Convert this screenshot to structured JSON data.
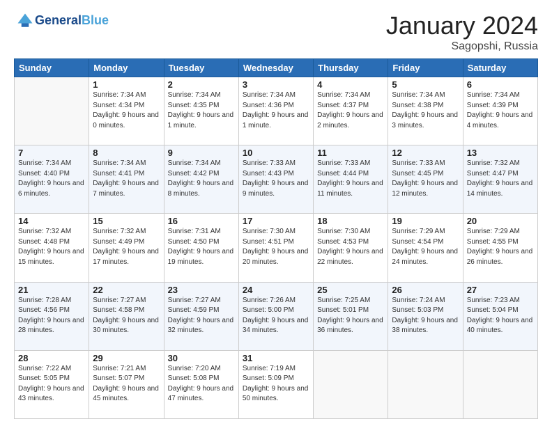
{
  "header": {
    "logo_general": "General",
    "logo_blue": "Blue",
    "month_title": "January 2024",
    "location": "Sagopshi, Russia"
  },
  "days_of_week": [
    "Sunday",
    "Monday",
    "Tuesday",
    "Wednesday",
    "Thursday",
    "Friday",
    "Saturday"
  ],
  "weeks": [
    [
      {
        "day": "",
        "sunrise": "",
        "sunset": "",
        "daylight": ""
      },
      {
        "day": "1",
        "sunrise": "Sunrise: 7:34 AM",
        "sunset": "Sunset: 4:34 PM",
        "daylight": "Daylight: 9 hours and 0 minutes."
      },
      {
        "day": "2",
        "sunrise": "Sunrise: 7:34 AM",
        "sunset": "Sunset: 4:35 PM",
        "daylight": "Daylight: 9 hours and 1 minute."
      },
      {
        "day": "3",
        "sunrise": "Sunrise: 7:34 AM",
        "sunset": "Sunset: 4:36 PM",
        "daylight": "Daylight: 9 hours and 1 minute."
      },
      {
        "day": "4",
        "sunrise": "Sunrise: 7:34 AM",
        "sunset": "Sunset: 4:37 PM",
        "daylight": "Daylight: 9 hours and 2 minutes."
      },
      {
        "day": "5",
        "sunrise": "Sunrise: 7:34 AM",
        "sunset": "Sunset: 4:38 PM",
        "daylight": "Daylight: 9 hours and 3 minutes."
      },
      {
        "day": "6",
        "sunrise": "Sunrise: 7:34 AM",
        "sunset": "Sunset: 4:39 PM",
        "daylight": "Daylight: 9 hours and 4 minutes."
      }
    ],
    [
      {
        "day": "7",
        "sunrise": "Sunrise: 7:34 AM",
        "sunset": "Sunset: 4:40 PM",
        "daylight": "Daylight: 9 hours and 6 minutes."
      },
      {
        "day": "8",
        "sunrise": "Sunrise: 7:34 AM",
        "sunset": "Sunset: 4:41 PM",
        "daylight": "Daylight: 9 hours and 7 minutes."
      },
      {
        "day": "9",
        "sunrise": "Sunrise: 7:34 AM",
        "sunset": "Sunset: 4:42 PM",
        "daylight": "Daylight: 9 hours and 8 minutes."
      },
      {
        "day": "10",
        "sunrise": "Sunrise: 7:33 AM",
        "sunset": "Sunset: 4:43 PM",
        "daylight": "Daylight: 9 hours and 9 minutes."
      },
      {
        "day": "11",
        "sunrise": "Sunrise: 7:33 AM",
        "sunset": "Sunset: 4:44 PM",
        "daylight": "Daylight: 9 hours and 11 minutes."
      },
      {
        "day": "12",
        "sunrise": "Sunrise: 7:33 AM",
        "sunset": "Sunset: 4:45 PM",
        "daylight": "Daylight: 9 hours and 12 minutes."
      },
      {
        "day": "13",
        "sunrise": "Sunrise: 7:32 AM",
        "sunset": "Sunset: 4:47 PM",
        "daylight": "Daylight: 9 hours and 14 minutes."
      }
    ],
    [
      {
        "day": "14",
        "sunrise": "Sunrise: 7:32 AM",
        "sunset": "Sunset: 4:48 PM",
        "daylight": "Daylight: 9 hours and 15 minutes."
      },
      {
        "day": "15",
        "sunrise": "Sunrise: 7:32 AM",
        "sunset": "Sunset: 4:49 PM",
        "daylight": "Daylight: 9 hours and 17 minutes."
      },
      {
        "day": "16",
        "sunrise": "Sunrise: 7:31 AM",
        "sunset": "Sunset: 4:50 PM",
        "daylight": "Daylight: 9 hours and 19 minutes."
      },
      {
        "day": "17",
        "sunrise": "Sunrise: 7:30 AM",
        "sunset": "Sunset: 4:51 PM",
        "daylight": "Daylight: 9 hours and 20 minutes."
      },
      {
        "day": "18",
        "sunrise": "Sunrise: 7:30 AM",
        "sunset": "Sunset: 4:53 PM",
        "daylight": "Daylight: 9 hours and 22 minutes."
      },
      {
        "day": "19",
        "sunrise": "Sunrise: 7:29 AM",
        "sunset": "Sunset: 4:54 PM",
        "daylight": "Daylight: 9 hours and 24 minutes."
      },
      {
        "day": "20",
        "sunrise": "Sunrise: 7:29 AM",
        "sunset": "Sunset: 4:55 PM",
        "daylight": "Daylight: 9 hours and 26 minutes."
      }
    ],
    [
      {
        "day": "21",
        "sunrise": "Sunrise: 7:28 AM",
        "sunset": "Sunset: 4:56 PM",
        "daylight": "Daylight: 9 hours and 28 minutes."
      },
      {
        "day": "22",
        "sunrise": "Sunrise: 7:27 AM",
        "sunset": "Sunset: 4:58 PM",
        "daylight": "Daylight: 9 hours and 30 minutes."
      },
      {
        "day": "23",
        "sunrise": "Sunrise: 7:27 AM",
        "sunset": "Sunset: 4:59 PM",
        "daylight": "Daylight: 9 hours and 32 minutes."
      },
      {
        "day": "24",
        "sunrise": "Sunrise: 7:26 AM",
        "sunset": "Sunset: 5:00 PM",
        "daylight": "Daylight: 9 hours and 34 minutes."
      },
      {
        "day": "25",
        "sunrise": "Sunrise: 7:25 AM",
        "sunset": "Sunset: 5:01 PM",
        "daylight": "Daylight: 9 hours and 36 minutes."
      },
      {
        "day": "26",
        "sunrise": "Sunrise: 7:24 AM",
        "sunset": "Sunset: 5:03 PM",
        "daylight": "Daylight: 9 hours and 38 minutes."
      },
      {
        "day": "27",
        "sunrise": "Sunrise: 7:23 AM",
        "sunset": "Sunset: 5:04 PM",
        "daylight": "Daylight: 9 hours and 40 minutes."
      }
    ],
    [
      {
        "day": "28",
        "sunrise": "Sunrise: 7:22 AM",
        "sunset": "Sunset: 5:05 PM",
        "daylight": "Daylight: 9 hours and 43 minutes."
      },
      {
        "day": "29",
        "sunrise": "Sunrise: 7:21 AM",
        "sunset": "Sunset: 5:07 PM",
        "daylight": "Daylight: 9 hours and 45 minutes."
      },
      {
        "day": "30",
        "sunrise": "Sunrise: 7:20 AM",
        "sunset": "Sunset: 5:08 PM",
        "daylight": "Daylight: 9 hours and 47 minutes."
      },
      {
        "day": "31",
        "sunrise": "Sunrise: 7:19 AM",
        "sunset": "Sunset: 5:09 PM",
        "daylight": "Daylight: 9 hours and 50 minutes."
      },
      {
        "day": "",
        "sunrise": "",
        "sunset": "",
        "daylight": ""
      },
      {
        "day": "",
        "sunrise": "",
        "sunset": "",
        "daylight": ""
      },
      {
        "day": "",
        "sunrise": "",
        "sunset": "",
        "daylight": ""
      }
    ]
  ]
}
